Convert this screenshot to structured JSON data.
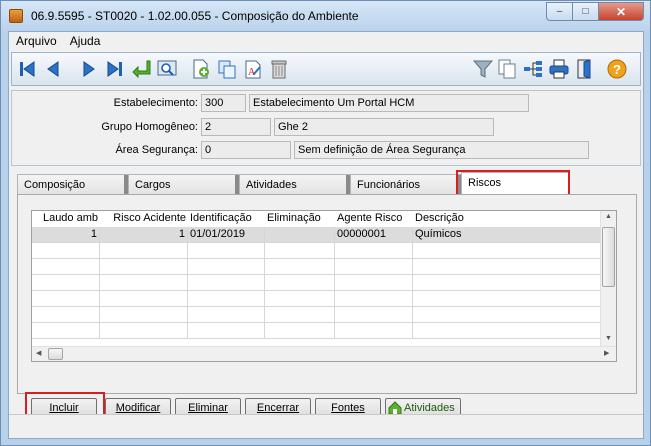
{
  "window": {
    "title": "06.9.5595 - ST0020 - 1.02.00.055 - Composição do Ambiente",
    "minimize": "–",
    "maximize": "□",
    "close": "✕"
  },
  "menu": {
    "items": [
      "Arquivo",
      "Ajuda"
    ]
  },
  "toolbar": {
    "icons": [
      "first-icon",
      "previous-icon",
      "next-icon",
      "last-icon",
      "goto-icon",
      "search-icon",
      "new-icon",
      "copy-icon",
      "edit-icon",
      "delete-icon",
      "filter-icon",
      "document-icon",
      "tree-icon",
      "print-icon",
      "exit-icon",
      "help-icon"
    ]
  },
  "header": {
    "estabelecimento_label": "Estabelecimento:",
    "estabelecimento_code": "300",
    "estabelecimento_name": "Estabelecimento Um Portal HCM",
    "grupo_label": "Grupo Homogêneo:",
    "grupo_code": "2",
    "grupo_name": "Ghe 2",
    "area_label": "Área Segurança:",
    "area_code": "0",
    "area_name": "Sem definição de Área Segurança"
  },
  "tabs": [
    "Composição",
    "Cargos",
    "Atividades",
    "Funcionários",
    "Riscos"
  ],
  "active_tab": "Riscos",
  "grid": {
    "columns": [
      "Laudo amb",
      "Risco Acidente",
      "Identificação",
      "Eliminação",
      "Agente Risco",
      "Descrição"
    ],
    "rows": [
      [
        "1",
        "1",
        "01/01/2019",
        "",
        "00000001",
        "Químicos"
      ]
    ]
  },
  "buttons": {
    "incluir": "Incluir",
    "modificar": "Modificar",
    "eliminar": "Eliminar",
    "encerrar": "Encerrar",
    "fontes": "Fontes",
    "atividades": "Atividades"
  },
  "colors": {
    "highlight": "#d62020",
    "accent": "#1f5fb0"
  }
}
